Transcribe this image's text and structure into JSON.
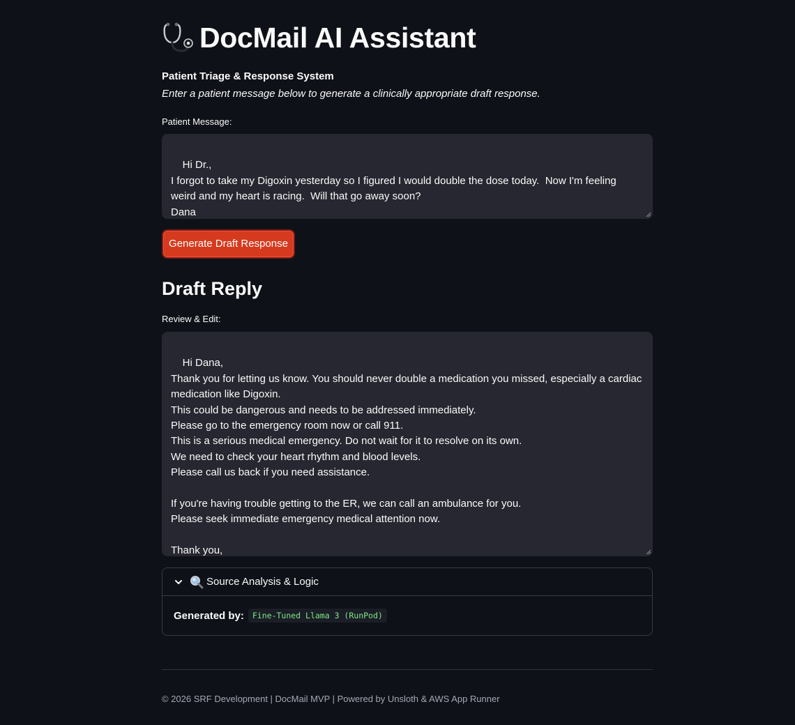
{
  "app": {
    "title": "DocMail AI Assistant",
    "title_icon": "stethoscope-icon",
    "subtitle": "Patient Triage & Response System",
    "intro": "Enter a patient message below to generate a clinically appropriate draft response."
  },
  "patient_message": {
    "label": "Patient Message:",
    "value": "Hi Dr.,\nI forgot to take my Digoxin yesterday so I figured I would double the dose today.  Now I'm feeling weird and my heart is racing.  Will that go away soon?\nDana"
  },
  "generate_button": {
    "label": "Generate Draft Response"
  },
  "draft": {
    "heading": "Draft Reply",
    "label": "Review & Edit:",
    "value": "Hi Dana,\nThank you for letting us know. You should never double a medication you missed, especially a cardiac medication like Digoxin.\nThis could be dangerous and needs to be addressed immediately.\nPlease go to the emergency room now or call 911.\nThis is a serious medical emergency. Do not wait for it to resolve on its own.\nWe need to check your heart rhythm and blood levels.\nPlease call us back if you need assistance.\n\nIf you're having trouble getting to the ER, we can call an ambulance for you.\nPlease seek immediate emergency medical attention now.\n\nThank you,\nDr. Martinez's Office"
  },
  "expander": {
    "title": "Source Analysis & Logic",
    "icon": "magnifying-glass-icon",
    "generated_by_label": "Generated by:",
    "generated_by_value": "Fine-Tuned Llama 3 (RunPod)"
  },
  "footer": {
    "text": "© 2026 SRF Development | DocMail MVP | Powered by Unsloth & AWS App Runner"
  },
  "colors": {
    "background": "#0e1117",
    "input_bg": "#262730",
    "primary_button": "#d63a1e",
    "code_text": "#7ee787"
  }
}
